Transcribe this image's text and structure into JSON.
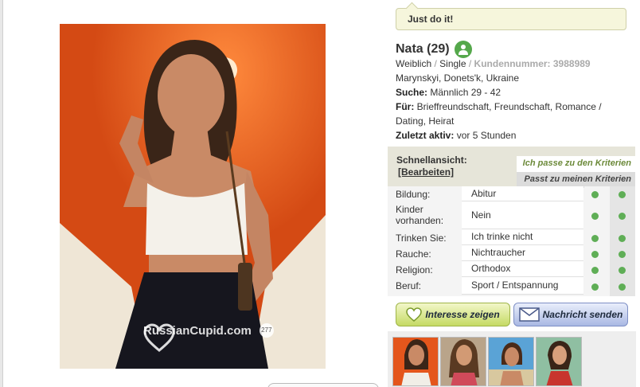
{
  "tagline": "Just do it!",
  "profile": {
    "name_age": "Nata (29)",
    "gender": "Weiblich",
    "status": "Single",
    "customer_number_label": "Kundennummer:",
    "customer_number": "3988989",
    "location": "Marynskyi, Donets'k, Ukraine",
    "search_label": "Suche:",
    "search_value": "Männlich 29 - 42",
    "for_label": "Für:",
    "for_line1": "Brieffreundschaft, Freundschaft, Romance /",
    "for_line2": "Dating, Heirat",
    "last_active_label": "Zuletzt aktiv:",
    "last_active_value": "vor 5 Stunden"
  },
  "photo": {
    "watermark": "RussianCupid.com",
    "badge": "277"
  },
  "quick_view": {
    "title": "Schnellansicht:",
    "edit_label": "[Bearbeiten]",
    "criteria_match_label": "Ich passe zu den Kriterien",
    "criteria_fit_label": "Passt zu meinen Kriterien",
    "rows": [
      {
        "label": "Bildung:",
        "value": "Abitur"
      },
      {
        "label": "Kinder vorhanden:",
        "value": "Nein"
      },
      {
        "label": "Trinken Sie:",
        "value": "Ich trinke nicht"
      },
      {
        "label": "Rauche:",
        "value": "Nichtraucher"
      },
      {
        "label": "Religion:",
        "value": "Orthodox"
      },
      {
        "label": "Beruf:",
        "value": "Sport / Entspannung"
      }
    ]
  },
  "actions": {
    "interest": "Interesse zeigen",
    "message": "Nachricht senden"
  },
  "colors": {
    "match_dot": "#5fae56",
    "photo_bg": "#e4561c",
    "tagline_bg": "#f6f6dc"
  }
}
